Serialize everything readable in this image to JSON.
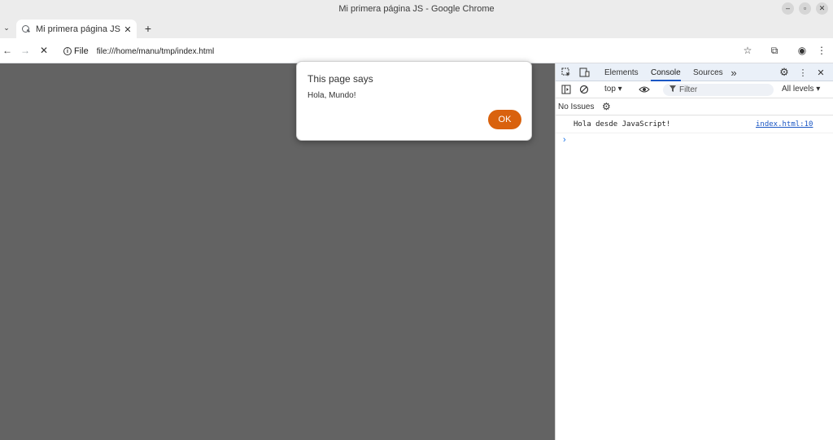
{
  "window": {
    "title": "Mi primera página JS - Google Chrome",
    "buttons": {
      "minimize": "–",
      "restore": "▫",
      "close": "✕"
    }
  },
  "tabs": {
    "list_button": "⌄",
    "active": {
      "title": "Mi primera página JS",
      "close": "✕"
    },
    "new_tab": "+"
  },
  "toolbar": {
    "back": "←",
    "forward": "→",
    "stop": "✕",
    "info_icon": "i",
    "scheme_label": "File",
    "url": "file:///home/manu/tmp/index.html",
    "bookmark": "☆",
    "extensions": "⧉",
    "profile": "◉",
    "menu": "⋮"
  },
  "dialog": {
    "title": "This page says",
    "message": "Hola, Mundo!",
    "ok_label": "OK"
  },
  "devtools": {
    "tabs": [
      "Elements",
      "Console",
      "Sources"
    ],
    "active_tab": "Console",
    "more_tabs": "»",
    "settings": "⚙",
    "kebab": "⋮",
    "close": "✕",
    "context": "top ▾",
    "filter_placeholder": "Filter",
    "levels": "All levels ▾",
    "issues_label": "No Issues",
    "console": {
      "message": "Hola desde JavaScript!",
      "source": "index.html:10",
      "prompt": "›"
    }
  },
  "colors": {
    "accent_ok": "#d9620e",
    "page_bg": "#636363",
    "link": "#1a56c4"
  }
}
